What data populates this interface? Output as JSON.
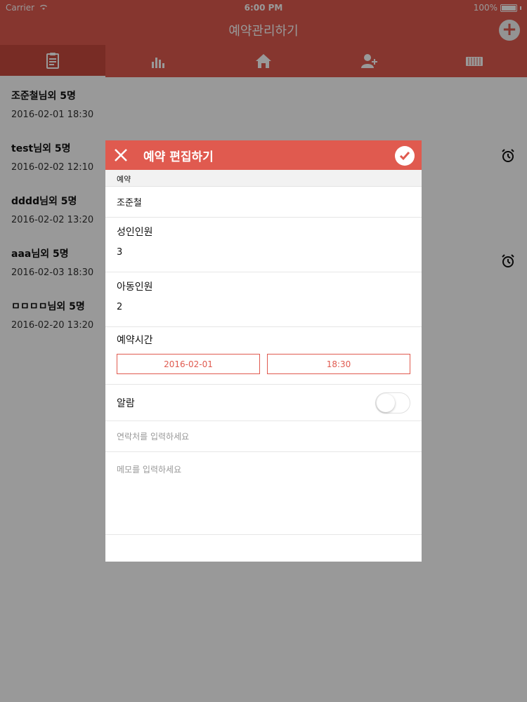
{
  "status_bar": {
    "carrier": "Carrier",
    "time": "6:00 PM",
    "battery": "100%"
  },
  "nav": {
    "title": "예약관리하기",
    "add_icon": "plus-circle-icon"
  },
  "tabs": [
    {
      "icon": "clipboard-icon",
      "active": true
    },
    {
      "icon": "bar-chart-icon",
      "active": false
    },
    {
      "icon": "home-icon",
      "active": false
    },
    {
      "icon": "add-person-icon",
      "active": false
    },
    {
      "icon": "keyboard-icon",
      "active": false
    }
  ],
  "list": [
    {
      "title": "조준철님외 5명",
      "date": "2016-02-01 18:30",
      "alarm": false
    },
    {
      "title": "test님외 5명",
      "date": "2016-02-02 12:10",
      "alarm": true
    },
    {
      "title": "dddd님외 5명",
      "date": "2016-02-02 13:20",
      "alarm": false
    },
    {
      "title": "aaa님외 5명",
      "date": "2016-02-03 18:30",
      "alarm": true
    },
    {
      "title": "ㅁㅁㅁㅁ님외 5명",
      "date": "2016-02-20 13:20",
      "alarm": false
    }
  ],
  "modal": {
    "title": "예약 편집하기",
    "section": "예약",
    "name": "조준철",
    "adults_label": "성인인원",
    "adults_value": "3",
    "children_label": "아동인원",
    "children_value": "2",
    "time_label": "예약시간",
    "date_value": "2016-02-01",
    "time_value": "18:30",
    "alarm_label": "알람",
    "alarm_on": false,
    "contact_placeholder": "연락처를 입력하세요",
    "memo_placeholder": "메모를 입력하세요"
  },
  "colors": {
    "accent": "#e05a4f",
    "accent_dark": "#c94a3f"
  }
}
